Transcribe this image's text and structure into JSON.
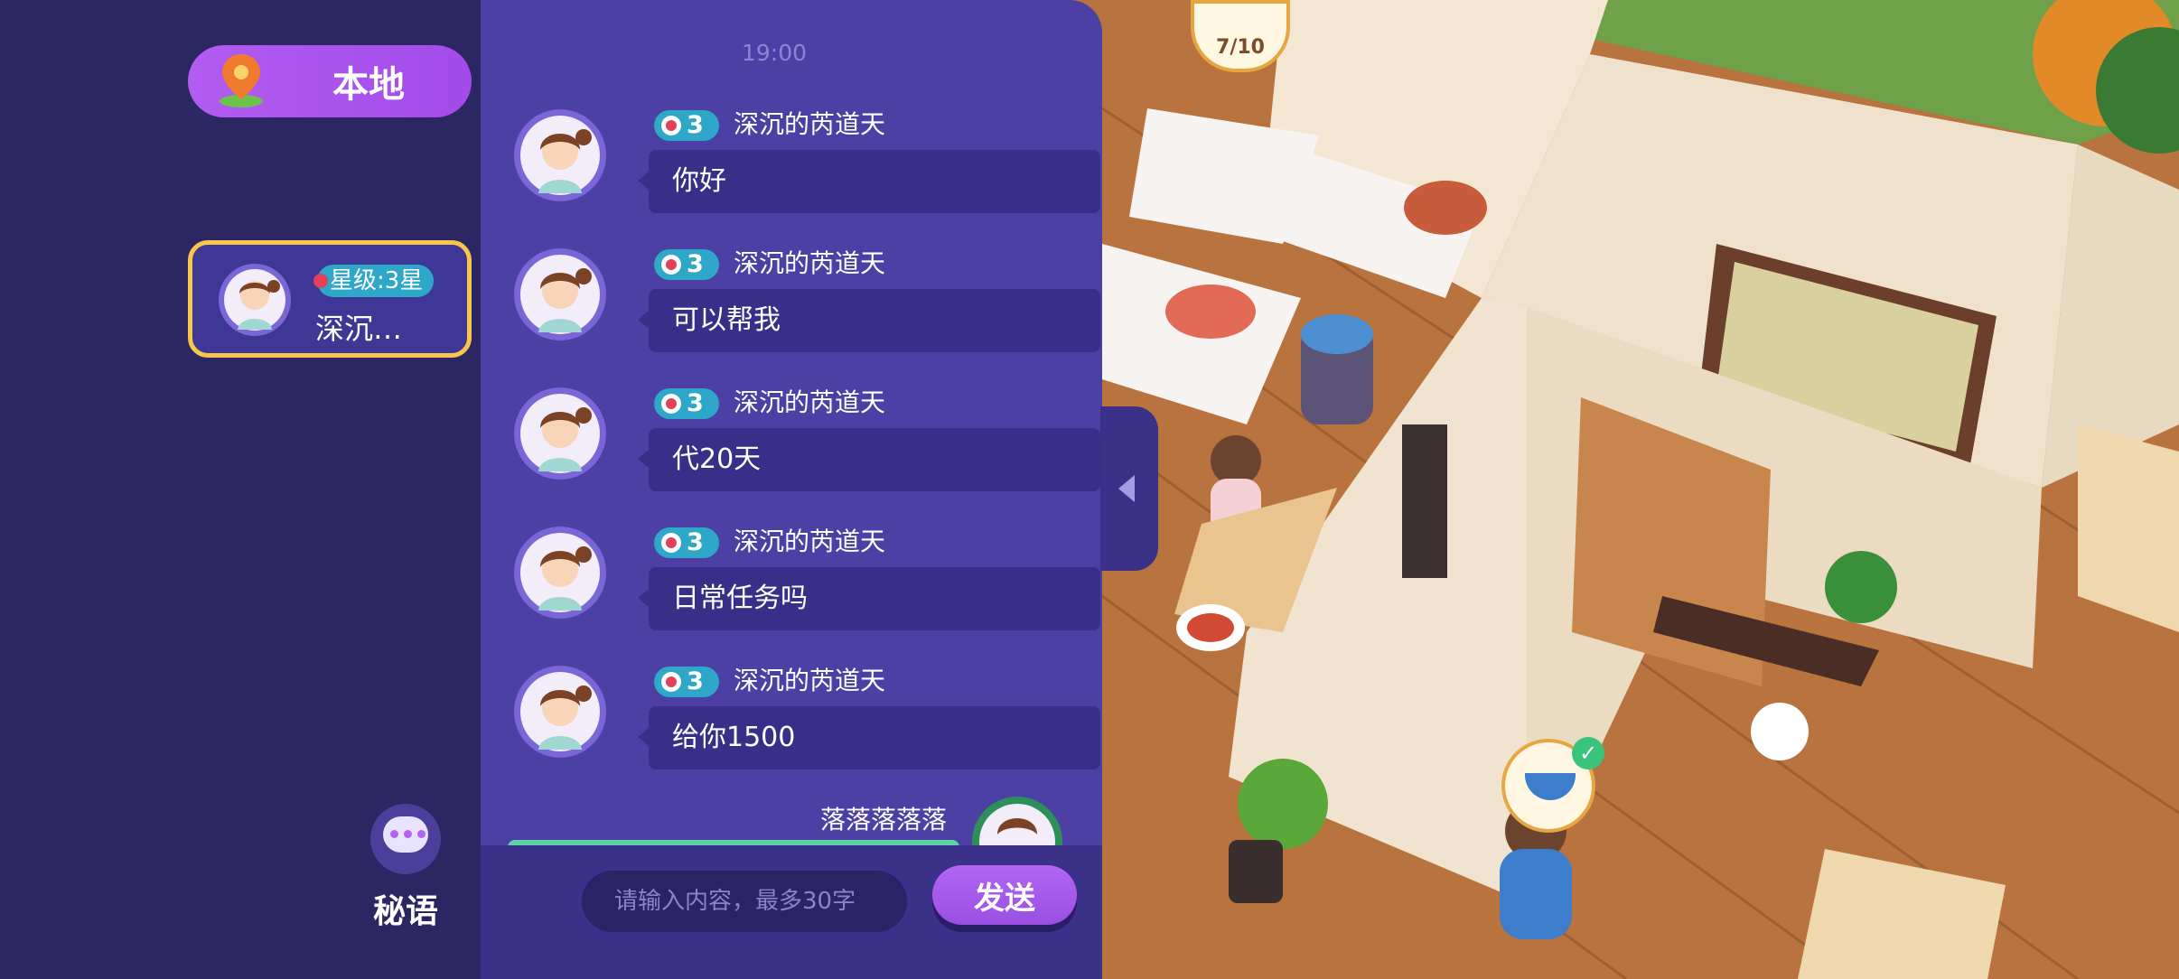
{
  "sidebar": {
    "channel_tab": {
      "label": "本地",
      "icon": "location-pin-icon"
    },
    "contact": {
      "level_label": "星级:3星",
      "name": "深沉…"
    },
    "whisper": {
      "label": "秘语",
      "icon": "chat-bubble-icon"
    }
  },
  "chat": {
    "time": "19:00",
    "messages": [
      {
        "level": "3",
        "sender": "深沉的芮道天",
        "text": "你好"
      },
      {
        "level": "3",
        "sender": "深沉的芮道天",
        "text": "可以帮我"
      },
      {
        "level": "3",
        "sender": "深沉的芮道天",
        "text": "代20天"
      },
      {
        "level": "3",
        "sender": "深沉的芮道天",
        "text": "日常任务吗"
      },
      {
        "level": "3",
        "sender": "深沉的芮道天",
        "text": "给你1500"
      }
    ],
    "self_message": {
      "sender": "落落落落落"
    },
    "input": {
      "placeholder": "请输入内容，最多30字"
    },
    "send_label": "发送"
  },
  "scene": {
    "order_progress": "7/10"
  },
  "colors": {
    "sidebar_bg": "#2c2763",
    "panel_bg": "#4c40a4",
    "accent_purple": "#a24be9",
    "level_badge": "#2ea7c9",
    "selected_border": "#f8c64a"
  }
}
